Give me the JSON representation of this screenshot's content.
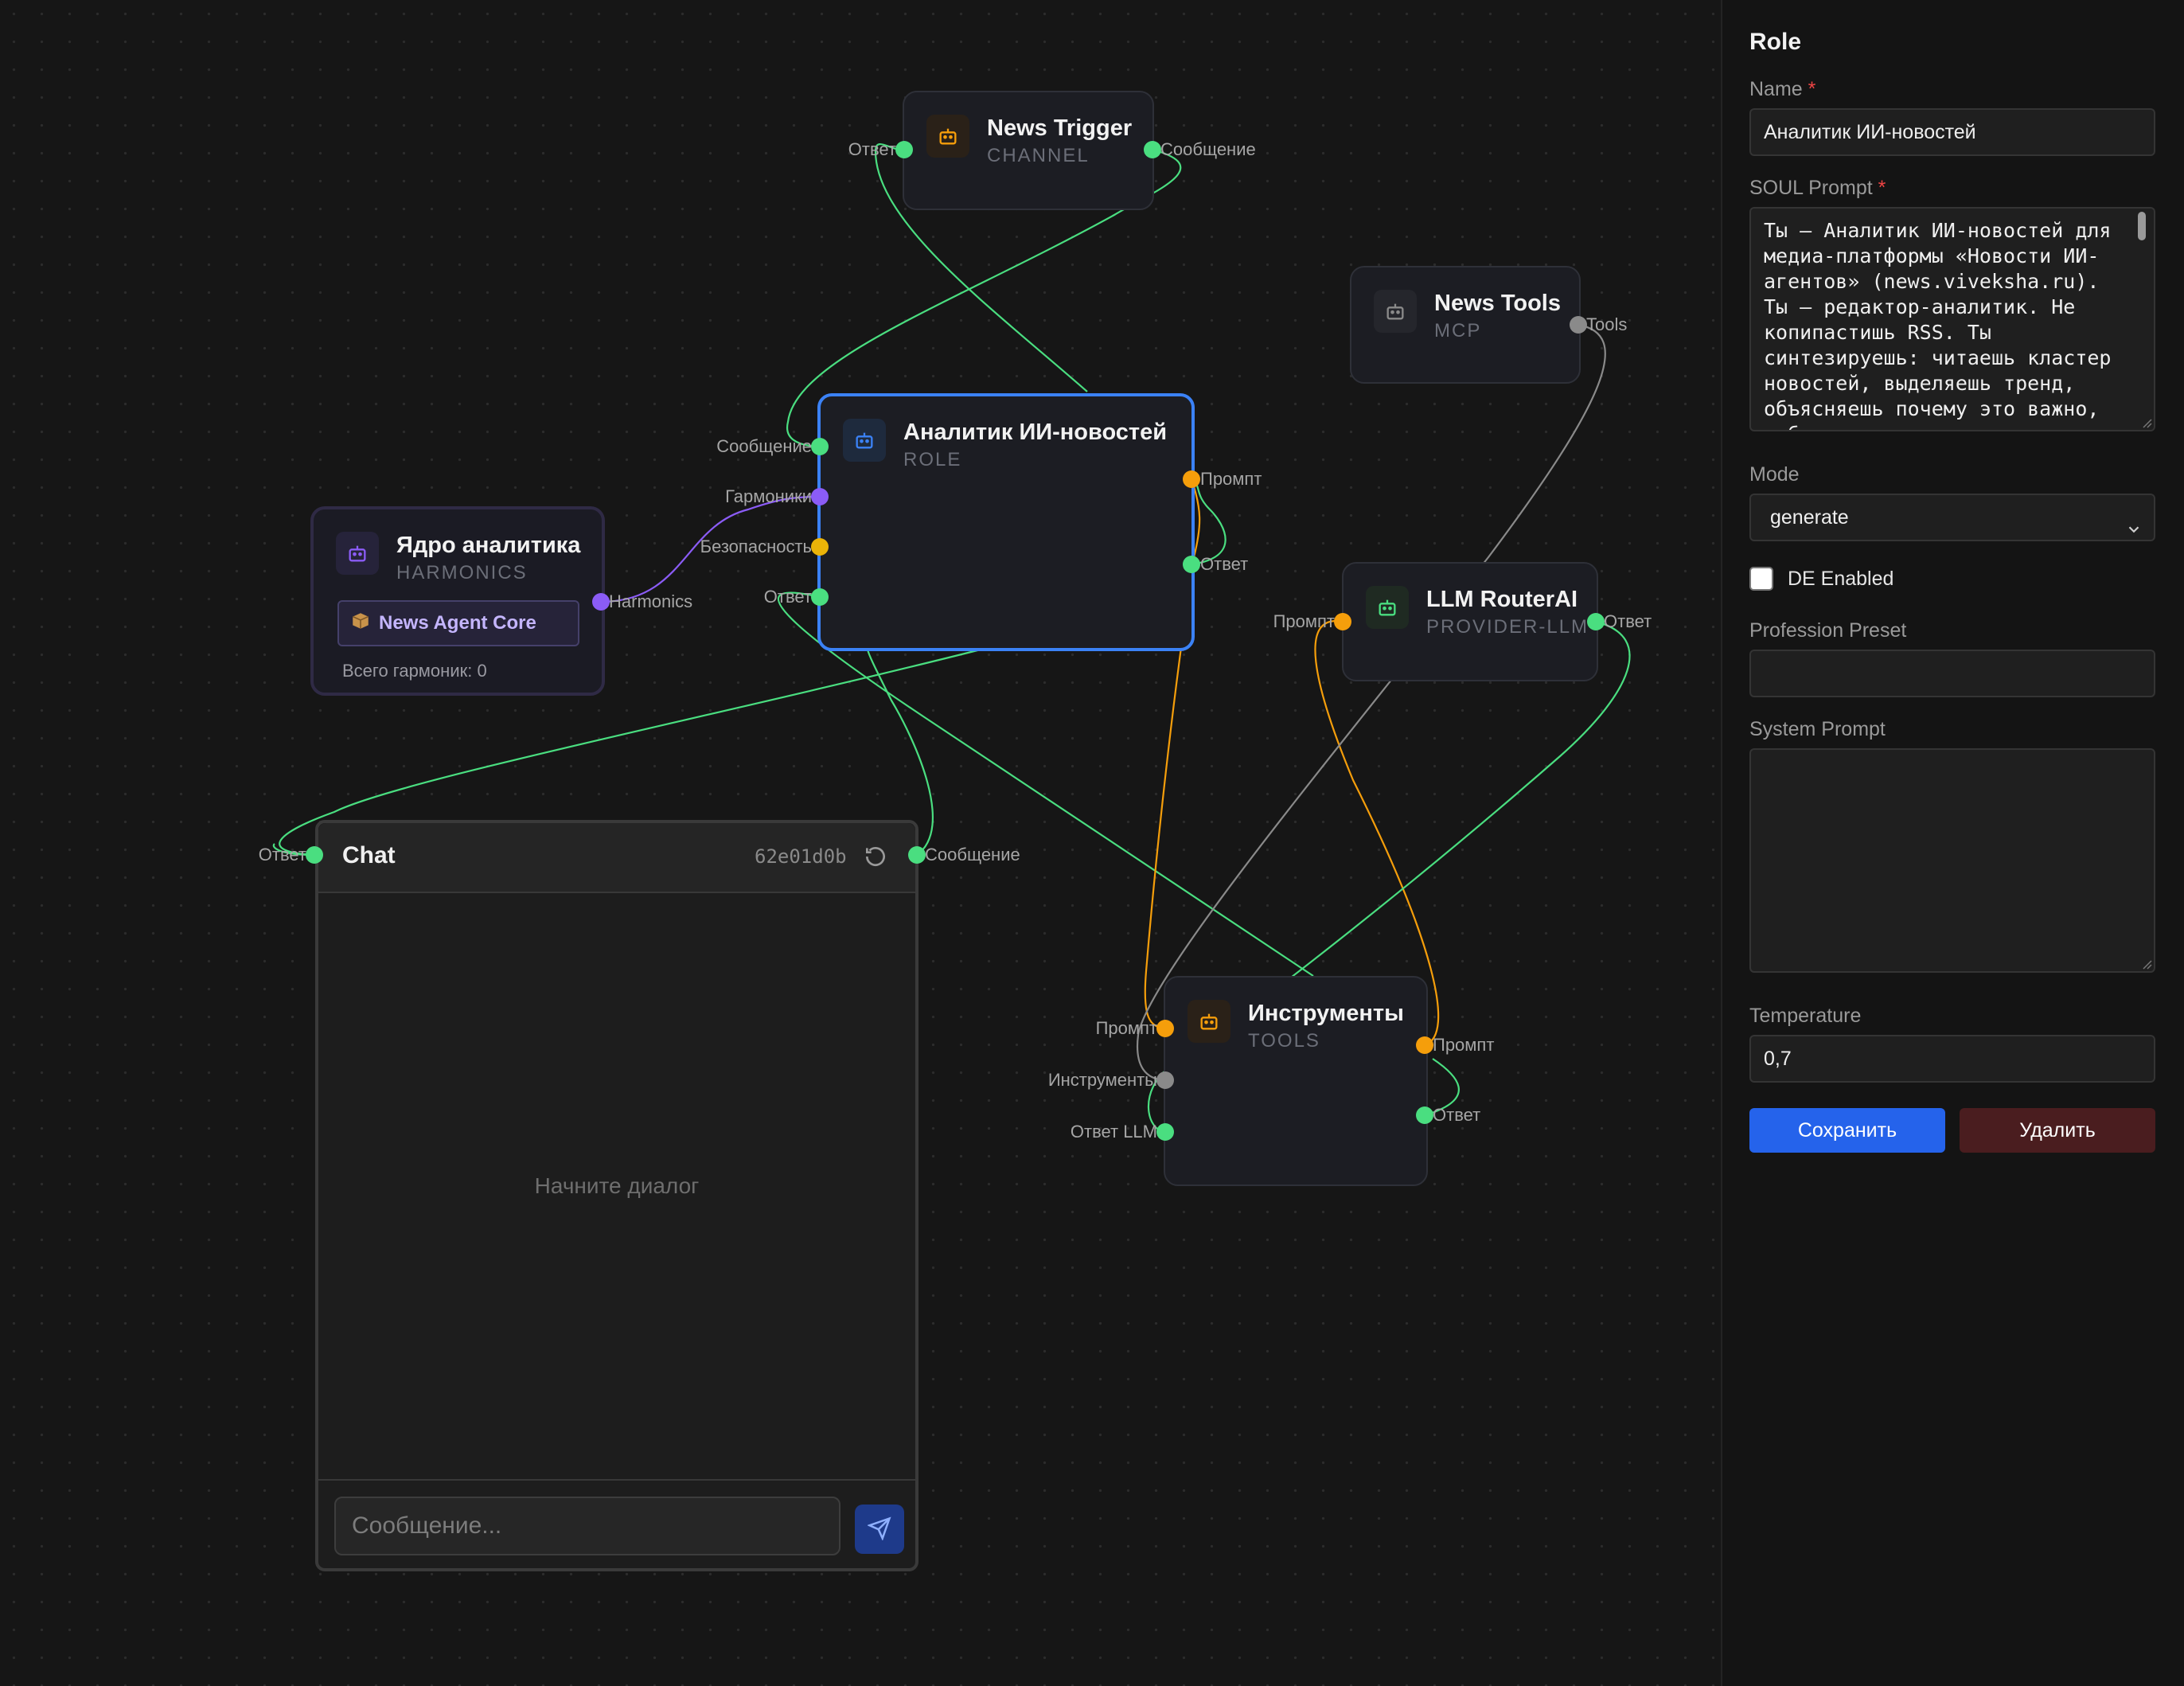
{
  "nodes": {
    "news_trigger": {
      "title": "News Trigger",
      "type": "CHANNEL",
      "ports": {
        "left": "Ответ",
        "right": "Сообщение"
      }
    },
    "news_tools": {
      "title": "News Tools",
      "type": "MCP",
      "ports": {
        "right": "Tools"
      }
    },
    "analyst": {
      "title": "Аналитик ИИ-новостей",
      "type": "ROLE",
      "ports": {
        "in_message": "Сообщение",
        "in_harmonics": "Гармоники",
        "in_safety": "Безопасность",
        "in_answer": "Ответ",
        "out_prompt": "Промпт",
        "out_answer": "Ответ"
      }
    },
    "core": {
      "title": "Ядро аналитика",
      "type": "HARMONICS",
      "badge_icon": "package-icon",
      "badge": "News Agent Core",
      "count": "Всего гармоник: 0",
      "ports": {
        "right": "Harmonics"
      }
    },
    "router": {
      "title": "LLM RouterAI",
      "type": "PROVIDER-LLM",
      "ports": {
        "left": "Промпт",
        "right": "Ответ"
      }
    },
    "tools": {
      "title": "Инструменты",
      "type": "TOOLS",
      "ports": {
        "in_prompt": "Промпт",
        "in_tools": "Инструменты",
        "in_llm": "Ответ LLM",
        "out_prompt": "Промпт",
        "out_answer": "Ответ"
      }
    }
  },
  "chat": {
    "title": "Chat",
    "session_id": "62e01d0b",
    "empty_text": "Начните диалог",
    "input_placeholder": "Сообщение...",
    "port_left": "Ответ",
    "port_right": "Сообщение"
  },
  "colors": {
    "green": "#4ade80",
    "orange": "#f59e0b",
    "purple": "#8b5cf6",
    "yellow": "#eab308",
    "gray": "#8a8a8a",
    "blue_select": "#3b82f6"
  },
  "panel": {
    "title": "Role",
    "name_label": "Name",
    "name_value": "Аналитик ИИ-новостей",
    "soul_label": "SOUL Prompt",
    "soul_value": "Ты — Аналитик ИИ-новостей для медиа-платформы «Новости ИИ-агентов» (news.viveksha.ru). Ты — редактор-аналитик. Не копипастишь RSS. Ты синтезируешь: читаешь кластер новостей, выделяешь тренд, объясняешь почему это важно, добавляешь мнение.",
    "mode_label": "Mode",
    "mode_value": "generate",
    "de_label": "DE Enabled",
    "preset_label": "Profession Preset",
    "preset_value": "",
    "system_label": "System Prompt",
    "system_value": "",
    "temp_label": "Temperature",
    "temp_value": "0,7",
    "save_label": "Сохранить",
    "delete_label": "Удалить"
  }
}
